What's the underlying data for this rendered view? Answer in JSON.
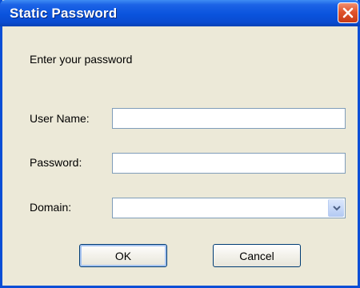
{
  "window": {
    "title": "Static Password",
    "close_icon": "close-icon"
  },
  "dialog": {
    "prompt": "Enter your password",
    "username": {
      "label": "User Name:",
      "value": ""
    },
    "password": {
      "label": "Password:",
      "value": ""
    },
    "domain": {
      "label": "Domain:",
      "selected": "",
      "dropdown_icon": "chevron-down-icon"
    }
  },
  "buttons": {
    "ok_label": "OK",
    "cancel_label": "Cancel"
  },
  "colors": {
    "titlebar": "#0a53dd",
    "window_bg": "#ece9d8",
    "close": "#e0542c",
    "field_border": "#7f9db9"
  }
}
